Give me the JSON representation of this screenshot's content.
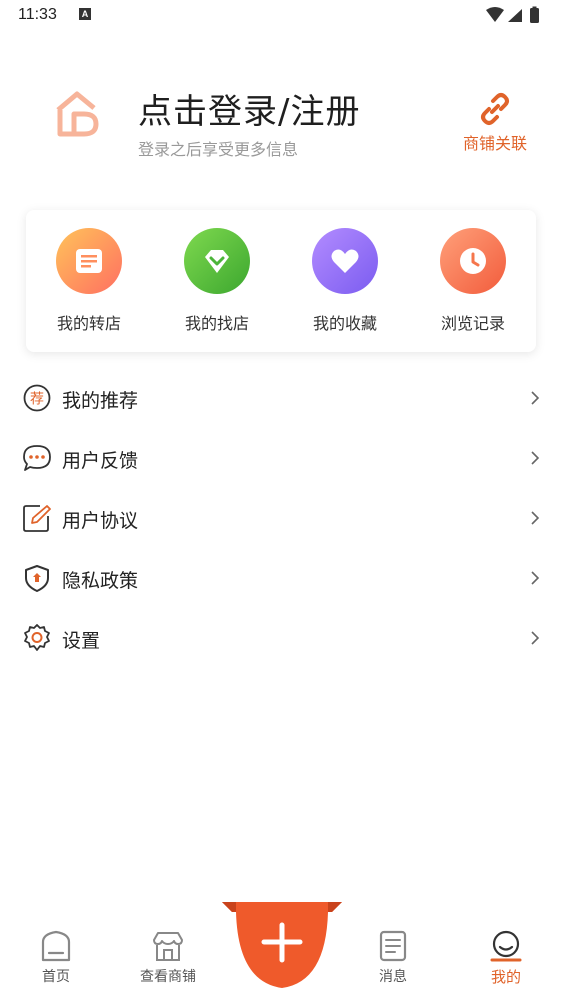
{
  "status_bar": {
    "time": "11:33",
    "notification_letter": "A"
  },
  "profile": {
    "title": "点击登录/注册",
    "subtitle": "登录之后享受更多信息",
    "shop_link_label": "商铺关联"
  },
  "quick_actions": [
    {
      "label": "我的转店",
      "icon": "store-list-icon",
      "color_from": "#ffc35a",
      "color_to": "#ff6f61"
    },
    {
      "label": "我的找店",
      "icon": "diamond-icon",
      "color_from": "#7fd94f",
      "color_to": "#3ca72f"
    },
    {
      "label": "我的收藏",
      "icon": "heart-icon",
      "color_from": "#b38cff",
      "color_to": "#7b5cf0"
    },
    {
      "label": "浏览记录",
      "icon": "clock-icon",
      "color_from": "#ffa07a",
      "color_to": "#f25c3c"
    }
  ],
  "menu": [
    {
      "label": "我的推荐",
      "icon": "recommend-badge-icon",
      "badge_char": "荐"
    },
    {
      "label": "用户反馈",
      "icon": "chat-bubble-icon"
    },
    {
      "label": "用户协议",
      "icon": "edit-document-icon"
    },
    {
      "label": "隐私政策",
      "icon": "shield-lock-icon"
    },
    {
      "label": "设置",
      "icon": "gear-icon"
    }
  ],
  "tabbar": {
    "tabs": [
      {
        "label": "首页",
        "icon": "home-icon",
        "active": false
      },
      {
        "label": "查看商铺",
        "icon": "storefront-icon",
        "active": false
      },
      {
        "label": "消息",
        "icon": "message-list-icon",
        "active": false
      },
      {
        "label": "我的",
        "icon": "profile-face-icon",
        "active": true
      }
    ],
    "fab_icon": "plus-icon"
  },
  "colors": {
    "accent": "#e0632a",
    "fab": "#ef5a2b",
    "text_primary": "#222222",
    "text_secondary": "#999999"
  }
}
